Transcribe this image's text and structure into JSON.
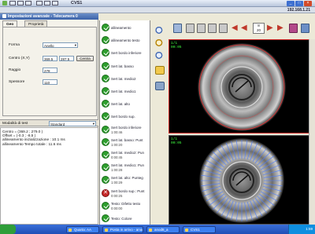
{
  "window": {
    "title": "CVS1"
  },
  "ipbar": {
    "ip": "192.168.1.21"
  },
  "panel": {
    "title": "Impostazioni avanzate - Telecamera 0",
    "tabs": [
      "Geo",
      "Proprietà"
    ],
    "form": {
      "forma_label": "Forma",
      "forma_value": "Anello",
      "centro_label": "Centro (X,Y)",
      "centro_x": "369.5",
      "centro_y": "287.5",
      "centra_button": "Centra",
      "raggio_label": "Raggio",
      "raggio_value": "278",
      "spessore_label": "Spessore",
      "spessore_value": "110"
    },
    "modality_label": "Modalità di test",
    "modality_value": "Standard"
  },
  "log": [
    "Centro = (369.2 ; 279.0 )",
    "Offset = (-0.3 ; -8.5 )",
    "allineamento inizializzazione : 10.1 ms",
    "allineamento Tempo totale : 11.6 ms"
  ],
  "operations": [
    {
      "name": "allineamento",
      "time": "",
      "status": "ok"
    },
    {
      "name": "allineamento testo",
      "time": "",
      "status": "ok"
    },
    {
      "name": "Sert bordo inferiore",
      "time": "",
      "status": "ok"
    },
    {
      "name": "Sert lat. basso",
      "time": "",
      "status": "ok"
    },
    {
      "name": "Sert lat. medio2",
      "time": "",
      "status": "ok"
    },
    {
      "name": "Sert lat. medio1",
      "time": "",
      "status": "ok"
    },
    {
      "name": "Sert lat. alto",
      "time": "",
      "status": "ok"
    },
    {
      "name": "Sert bordo sup.",
      "time": "",
      "status": "ok"
    },
    {
      "name": "Sert bordo inferiore",
      "time": "1:00:46",
      "status": "ok"
    },
    {
      "name": "Sert lat. basso: Punt",
      "time": "1:00:20",
      "status": "ok"
    },
    {
      "name": "Sert lat. medio2: Pun",
      "time": "0:00:45",
      "status": "ok"
    },
    {
      "name": "Sert lat. medio1: Pun",
      "time": "1:00:28",
      "status": "ok"
    },
    {
      "name": "Sert lat. alto: Punteg",
      "time": "1:00:29",
      "status": "ok"
    },
    {
      "name": "Sert bordo sup.: Punt",
      "time": "0:00:25",
      "status": "ko"
    },
    {
      "name": "Testo: Difetto testo",
      "time": "0:00:00",
      "status": "ok"
    },
    {
      "name": "Testo: Colore",
      "time": "",
      "status": "ok"
    }
  ],
  "toolbar": {
    "counter_top": "8",
    "counter_bottom": "20"
  },
  "cam1_label": [
    "1/1",
    "00:05"
  ],
  "cam2_label": [
    "1/1",
    "00:05"
  ],
  "taskbar": {
    "tasks": [
      "Quarta: AA",
      "Posta in arrivo - anod...",
      "anod8_a",
      "CVS1"
    ],
    "clock": "1:59"
  }
}
